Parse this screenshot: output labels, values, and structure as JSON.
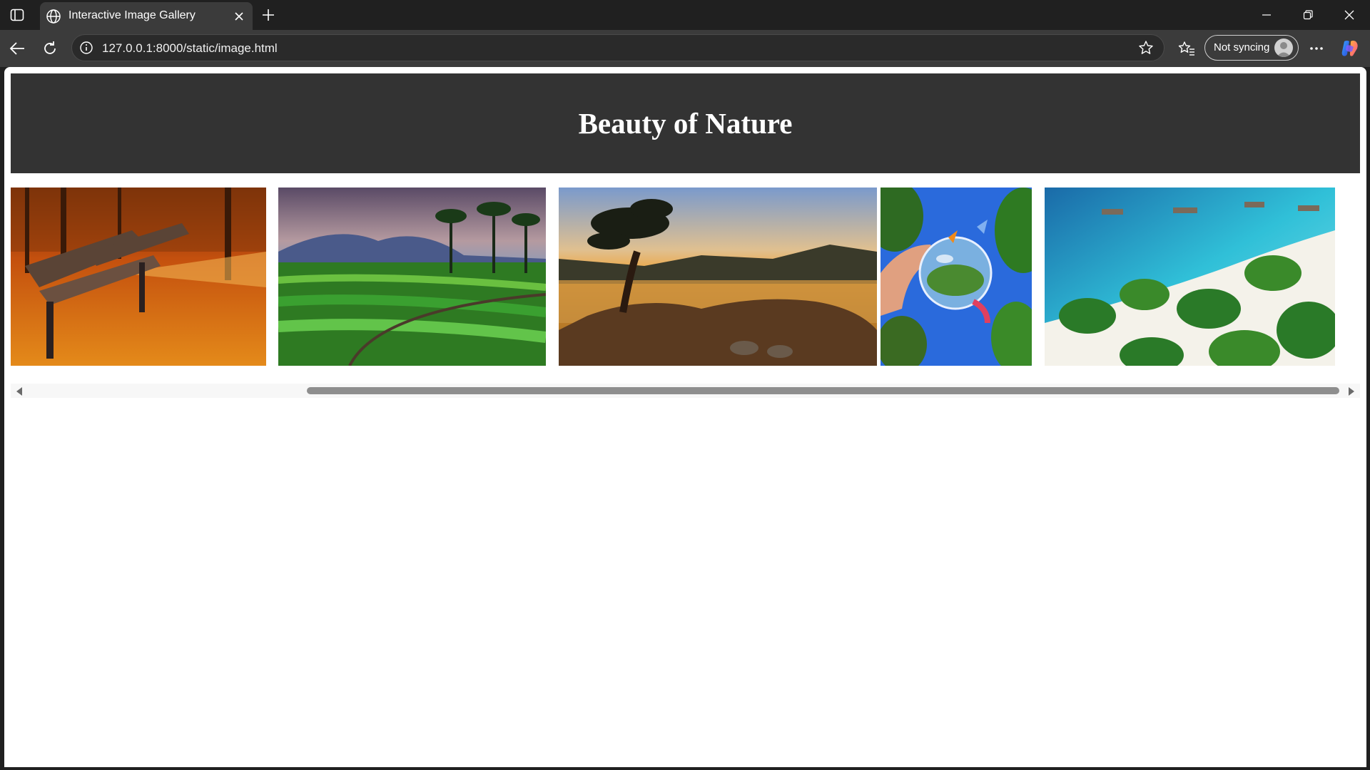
{
  "browser": {
    "tab_title": "Interactive Image Gallery",
    "url": "127.0.0.1:8000/static/image.html",
    "profile_label": "Not syncing",
    "icons": [
      "sidebar-icon",
      "globe-icon",
      "close-icon",
      "plus-icon",
      "minimize-icon",
      "restore-icon",
      "close-window-icon",
      "back-arrow-icon",
      "refresh-icon",
      "info-icon",
      "star-icon",
      "favorites-icon",
      "avatar-icon",
      "more-icon",
      "copilot-icon"
    ]
  },
  "page": {
    "title": "Beauty of Nature",
    "images": [
      {
        "subject": "autumn-park-benches"
      },
      {
        "subject": "rice-terraces-mountain"
      },
      {
        "subject": "lake-tree-sunset"
      },
      {
        "subject": "hand-crystal-ball-butterflies"
      },
      {
        "subject": "tropical-beach-palms"
      }
    ],
    "horizontal_scroll_position": 0.22
  },
  "colors": {
    "banner_bg": "#333333",
    "browser_chrome": "#202020",
    "toolbar": "#3b3b3b"
  }
}
